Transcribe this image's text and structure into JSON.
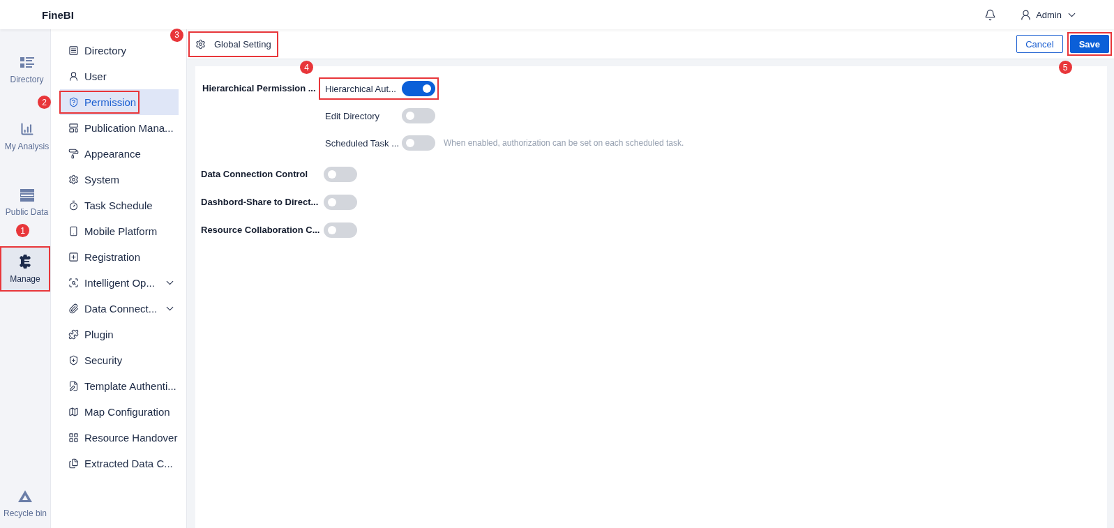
{
  "app": {
    "name": "FineBI"
  },
  "user": {
    "name": "Admin"
  },
  "rail": [
    {
      "label": "Directory",
      "selected": false,
      "annotated": false
    },
    {
      "label": "My Analysis",
      "selected": false,
      "annotated": false
    },
    {
      "label": "Public Data",
      "selected": false,
      "annotated": false
    },
    {
      "label": "Manage",
      "selected": true,
      "annotated": true,
      "marker": "1"
    }
  ],
  "rail_bottom": {
    "label": "Recycle bin"
  },
  "nav": [
    {
      "label": "Directory",
      "selected": false,
      "annotated": false,
      "expandable": false
    },
    {
      "label": "User",
      "selected": false,
      "annotated": false,
      "expandable": false
    },
    {
      "label": "Permission",
      "selected": true,
      "annotated": true,
      "marker": "2",
      "expandable": false
    },
    {
      "label": "Publication Mana...",
      "selected": false,
      "annotated": false,
      "expandable": false
    },
    {
      "label": "Appearance",
      "selected": false,
      "annotated": false,
      "expandable": false
    },
    {
      "label": "System",
      "selected": false,
      "annotated": false,
      "expandable": false
    },
    {
      "label": "Task Schedule",
      "selected": false,
      "annotated": false,
      "expandable": false
    },
    {
      "label": "Mobile Platform",
      "selected": false,
      "annotated": false,
      "expandable": false
    },
    {
      "label": "Registration",
      "selected": false,
      "annotated": false,
      "expandable": false
    },
    {
      "label": "Intelligent Op...",
      "selected": false,
      "annotated": false,
      "expandable": true
    },
    {
      "label": "Data Connect...",
      "selected": false,
      "annotated": false,
      "expandable": true
    },
    {
      "label": "Plugin",
      "selected": false,
      "annotated": false,
      "expandable": false
    },
    {
      "label": "Security",
      "selected": false,
      "annotated": false,
      "expandable": false
    },
    {
      "label": "Template Authenti...",
      "selected": false,
      "annotated": false,
      "expandable": false
    },
    {
      "label": "Map Configuration",
      "selected": false,
      "annotated": false,
      "expandable": false
    },
    {
      "label": "Resource Handover",
      "selected": false,
      "annotated": false,
      "expandable": false
    },
    {
      "label": "Extracted Data C...",
      "selected": false,
      "annotated": false,
      "expandable": false
    }
  ],
  "page": {
    "title": "Global Setting",
    "annotated": true,
    "marker": "3"
  },
  "actions": [
    {
      "label": "Cancel",
      "kind": "secondary",
      "annotated": false
    },
    {
      "label": "Save",
      "kind": "primary",
      "annotated": true,
      "marker": "5"
    }
  ],
  "settings": [
    {
      "kind": "group",
      "label": "Hierarchical Permission ...",
      "options": [
        {
          "label": "Hierarchical Aut...",
          "on": true,
          "annotated": true,
          "marker": "4"
        },
        {
          "label": "Edit Directory",
          "on": false,
          "annotated": false
        },
        {
          "label": "Scheduled Task ...",
          "on": false,
          "annotated": false,
          "hint": "When enabled, authorization can be set on each scheduled task."
        }
      ]
    },
    {
      "kind": "switch",
      "label": "Data Connection Control",
      "on": false
    },
    {
      "kind": "switch",
      "label": "Dashbord-Share to Direct...",
      "on": false
    },
    {
      "kind": "switch",
      "label": "Resource Collaboration C...",
      "on": false
    }
  ]
}
